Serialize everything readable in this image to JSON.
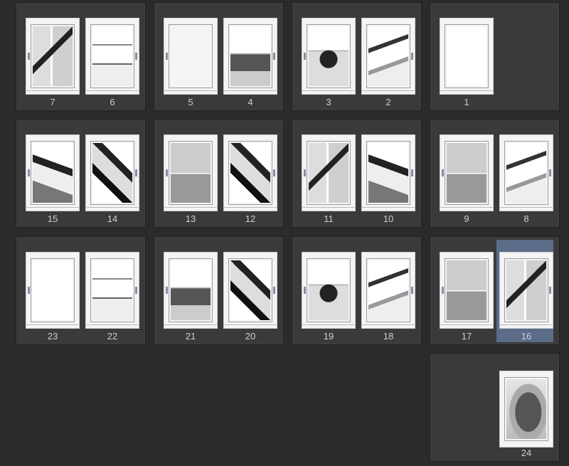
{
  "spreads": [
    {
      "left": "7",
      "right": "6"
    },
    {
      "left": "5",
      "right": "4"
    },
    {
      "left": "3",
      "right": "2"
    },
    {
      "left": "",
      "right": "1"
    },
    {
      "left": "15",
      "right": "14"
    },
    {
      "left": "13",
      "right": "12"
    },
    {
      "left": "11",
      "right": "10"
    },
    {
      "left": "9",
      "right": "8"
    },
    {
      "left": "23",
      "right": "22"
    },
    {
      "left": "21",
      "right": "20"
    },
    {
      "left": "19",
      "right": "18"
    },
    {
      "left": "17",
      "right": "16"
    },
    {
      "left": "",
      "right": "24"
    }
  ],
  "selected_page": "16",
  "colors": {
    "background": "#2b2b2b",
    "panel": "#3a3a3a",
    "selection": "#5b6c88",
    "page_number_text": "#cfcfcf"
  }
}
